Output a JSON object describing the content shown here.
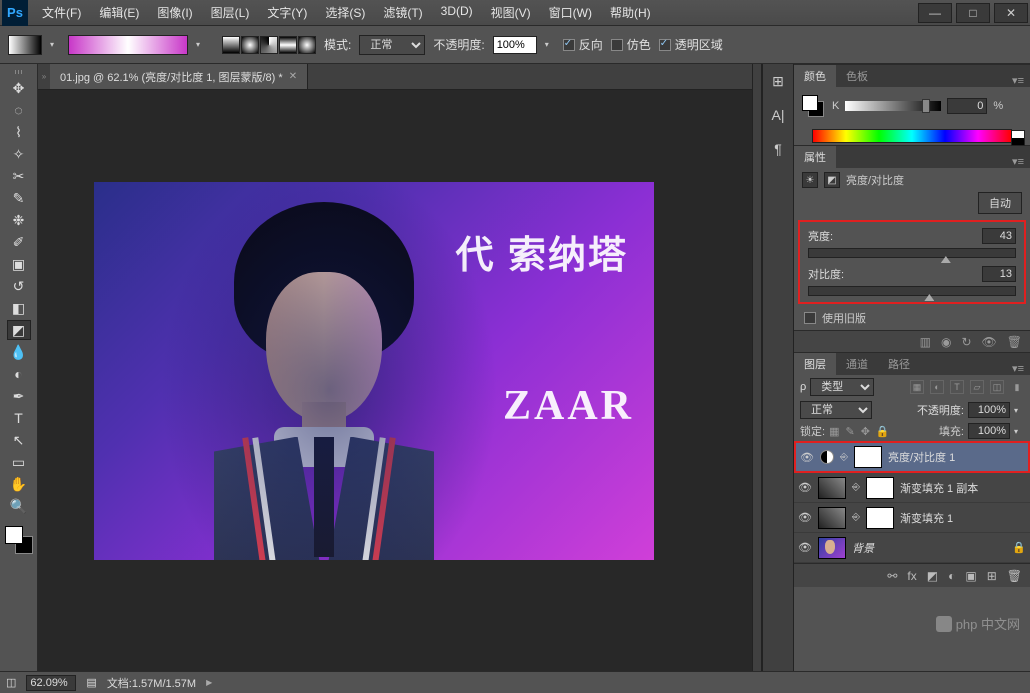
{
  "menu": {
    "file": "文件(F)",
    "edit": "编辑(E)",
    "image": "图像(I)",
    "layer": "图层(L)",
    "type": "文字(Y)",
    "select": "选择(S)",
    "filter": "滤镜(T)",
    "threeD": "3D(D)",
    "view": "视图(V)",
    "window": "窗口(W)",
    "help": "帮助(H)"
  },
  "options": {
    "mode_label": "模式:",
    "mode_value": "正常",
    "opacity_label": "不透明度:",
    "opacity_value": "100%",
    "reverse": "反向",
    "dither": "仿色",
    "transparency": "透明区域"
  },
  "document": {
    "tab_title": "01.jpg @ 62.1% (亮度/对比度 1, 图层蒙版/8) *"
  },
  "canvas_text": {
    "t1": "代 索纳塔",
    "t2": "ZAAR"
  },
  "color_panel": {
    "tab_color": "颜色",
    "tab_swatches": "色板",
    "channel": "K",
    "value": "0",
    "unit": "%"
  },
  "properties": {
    "tab": "属性",
    "title": "亮度/对比度",
    "auto": "自动",
    "brightness_label": "亮度:",
    "brightness_value": "43",
    "contrast_label": "对比度:",
    "contrast_value": "13",
    "legacy": "使用旧版"
  },
  "layers": {
    "tab_layers": "图层",
    "tab_channels": "通道",
    "tab_paths": "路径",
    "filter_kind": "类型",
    "blend_mode": "正常",
    "opacity_label": "不透明度:",
    "opacity_value": "100%",
    "lock_label": "锁定:",
    "fill_label": "填充:",
    "fill_value": "100%",
    "items": [
      {
        "name": "亮度/对比度 1"
      },
      {
        "name": "渐变填充 1 副本"
      },
      {
        "name": "渐变填充 1"
      },
      {
        "name": "背景"
      }
    ]
  },
  "status": {
    "zoom": "62.09%",
    "doc_info": "文档:1.57M/1.57M"
  },
  "watermark": "php 中文网"
}
